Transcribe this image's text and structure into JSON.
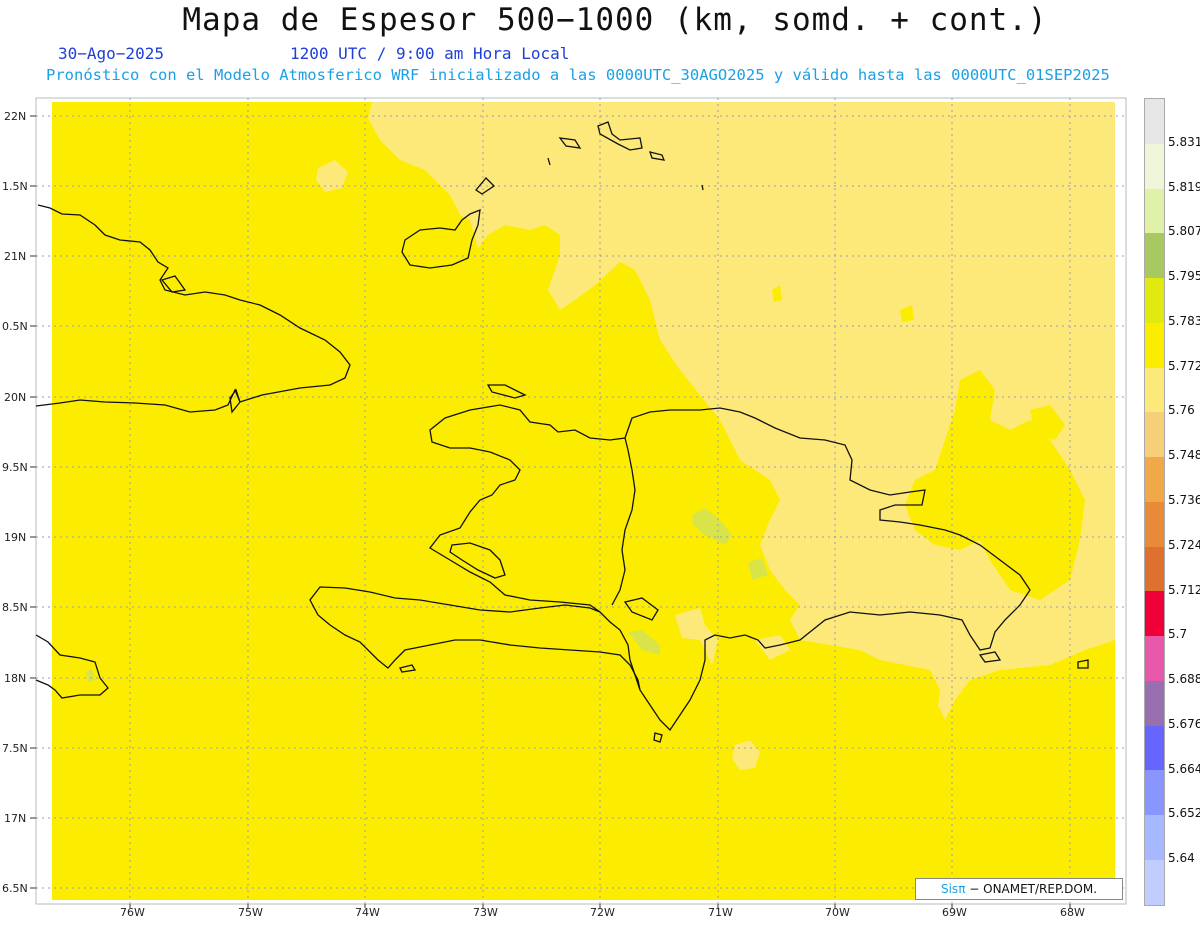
{
  "header": {
    "title": "Mapa de Espesor 500−1000 (km, somd. + cont.)",
    "date": "30−Ago−2025",
    "utc": "1200 UTC / 9:00 am Hora Local",
    "subtitle": "Pronóstico con el Modelo Atmosferico WRF inicializado a las 0000UTC_30AGO2025 y válido hasta las  0000UTC_01SEP2025"
  },
  "map": {
    "lat_labels": [
      "22N",
      "1.5N",
      "21N",
      "0.5N",
      "20N",
      "9.5N",
      "19N",
      "8.5N",
      "18N",
      "7.5N",
      "17N",
      "6.5N"
    ],
    "lon_labels": [
      "76W",
      "75W",
      "74W",
      "73W",
      "72W",
      "71W",
      "70W",
      "69W",
      "68W"
    ],
    "colors": {
      "base": "#fced00",
      "lighter": "#fde97a",
      "greenish": "#d8e44a",
      "coast": "#111111",
      "grid": "#9a9ac0"
    }
  },
  "colorbar": {
    "labels": [
      "5.831",
      "5.819",
      "5.807",
      "5.795",
      "5.783",
      "5.772",
      "5.76",
      "5.748",
      "5.736",
      "5.724",
      "5.712",
      "5.7",
      "5.688",
      "5.676",
      "5.664",
      "5.652",
      "5.64"
    ],
    "colors": [
      "#e6e6e6",
      "#eef5d8",
      "#dff2a8",
      "#a8c860",
      "#e0ea10",
      "#fced00",
      "#fde97a",
      "#f5d078",
      "#f0a848",
      "#e88a38",
      "#de7030",
      "#f00038",
      "#e858a8",
      "#9870b0",
      "#6666ff",
      "#8a96ff",
      "#a6b8ff",
      "#c2cdff"
    ]
  },
  "credit": {
    "brand": "Sisπ",
    "text": "− ONAMET/REP.DOM."
  }
}
